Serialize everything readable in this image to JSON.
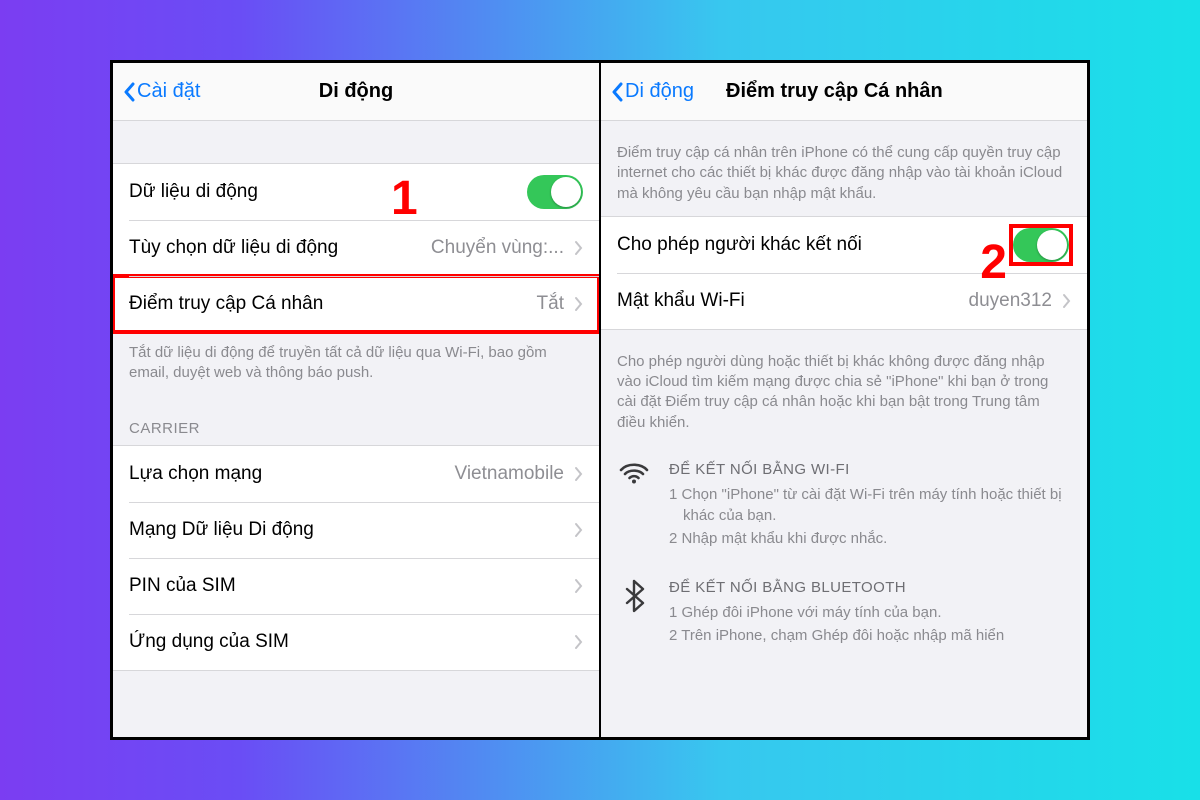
{
  "colors": {
    "accent": "#0a7aff",
    "toggle_on": "#34c759",
    "callout": "#ff0000"
  },
  "callout1": "1",
  "callout2": "2",
  "left_panel": {
    "back_label": "Cài đặt",
    "title": "Di động",
    "rows": {
      "mobile_data": {
        "label": "Dữ liệu di động",
        "toggle_on": true
      },
      "data_options": {
        "label": "Tùy chọn dữ liệu di động",
        "value": "Chuyển vùng:..."
      },
      "personal_hotspot": {
        "label": "Điểm truy cập Cá nhân",
        "value": "Tắt"
      }
    },
    "footer1": "Tắt dữ liệu di động để truyền tất cả dữ liệu qua Wi-Fi, bao gồm email, duyệt web và thông báo push.",
    "section_carrier": "CARRIER",
    "rows2": {
      "network_selection": {
        "label": "Lựa chọn mạng",
        "value": "Vietnamobile"
      },
      "mobile_data_network": {
        "label": "Mạng Dữ liệu Di động"
      },
      "sim_pin": {
        "label": "PIN của SIM"
      },
      "sim_apps": {
        "label": "Ứng dụng của SIM"
      }
    }
  },
  "right_panel": {
    "back_label": "Di động",
    "title": "Điểm truy cập Cá nhân",
    "header_text": "Điểm truy cập cá nhân trên iPhone có thể cung cấp quyền truy cập internet cho các thiết bị khác được đăng nhập vào tài khoản iCloud mà không yêu cầu bạn nhập mật khẩu.",
    "rows": {
      "allow_others": {
        "label": "Cho phép người khác kết nối",
        "toggle_on": true
      },
      "wifi_password": {
        "label": "Mật khẩu Wi-Fi",
        "value": "duyen312"
      }
    },
    "footer1": "Cho phép người dùng hoặc thiết bị khác không được đăng nhập vào iCloud tìm kiếm mạng được chia sẻ \"iPhone\" khi bạn ở trong cài đặt Điểm truy cập cá nhân hoặc khi bạn bật trong Trung tâm điều khiển.",
    "wifi_instr": {
      "heading": "ĐỂ KẾT NỐI BẰNG WI-FI",
      "line1": "1 Chọn \"iPhone\" từ cài đặt Wi-Fi trên máy tính hoặc thiết bị khác của bạn.",
      "line2": "2 Nhập mật khẩu khi được nhắc."
    },
    "bt_instr": {
      "heading": "ĐỂ KẾT NỐI BẰNG BLUETOOTH",
      "line1": "1 Ghép đôi iPhone với máy tính của bạn.",
      "line2": "2 Trên iPhone, chạm Ghép đôi hoặc nhập mã hiển"
    }
  }
}
